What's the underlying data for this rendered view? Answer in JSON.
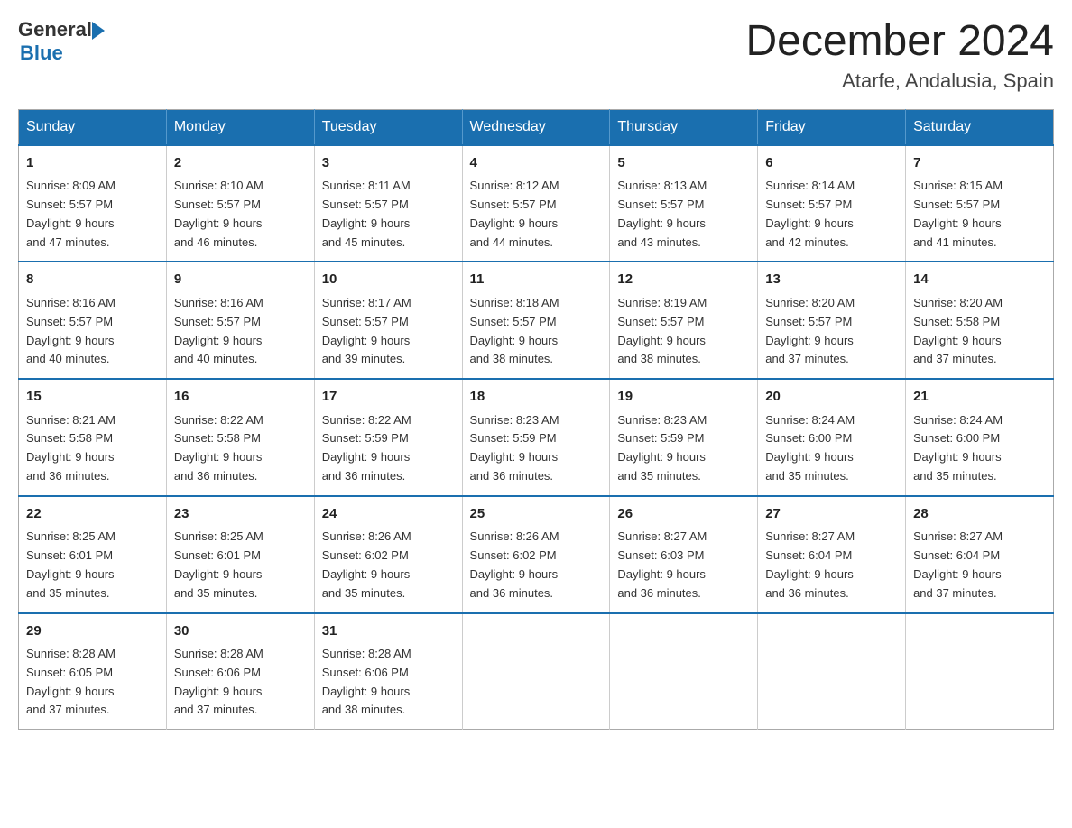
{
  "header": {
    "logo_general": "General",
    "logo_blue": "Blue",
    "title": "December 2024",
    "subtitle": "Atarfe, Andalusia, Spain"
  },
  "weekdays": [
    "Sunday",
    "Monday",
    "Tuesday",
    "Wednesday",
    "Thursday",
    "Friday",
    "Saturday"
  ],
  "weeks": [
    [
      {
        "day": "1",
        "sunrise": "8:09 AM",
        "sunset": "5:57 PM",
        "daylight": "9 hours and 47 minutes."
      },
      {
        "day": "2",
        "sunrise": "8:10 AM",
        "sunset": "5:57 PM",
        "daylight": "9 hours and 46 minutes."
      },
      {
        "day": "3",
        "sunrise": "8:11 AM",
        "sunset": "5:57 PM",
        "daylight": "9 hours and 45 minutes."
      },
      {
        "day": "4",
        "sunrise": "8:12 AM",
        "sunset": "5:57 PM",
        "daylight": "9 hours and 44 minutes."
      },
      {
        "day": "5",
        "sunrise": "8:13 AM",
        "sunset": "5:57 PM",
        "daylight": "9 hours and 43 minutes."
      },
      {
        "day": "6",
        "sunrise": "8:14 AM",
        "sunset": "5:57 PM",
        "daylight": "9 hours and 42 minutes."
      },
      {
        "day": "7",
        "sunrise": "8:15 AM",
        "sunset": "5:57 PM",
        "daylight": "9 hours and 41 minutes."
      }
    ],
    [
      {
        "day": "8",
        "sunrise": "8:16 AM",
        "sunset": "5:57 PM",
        "daylight": "9 hours and 40 minutes."
      },
      {
        "day": "9",
        "sunrise": "8:16 AM",
        "sunset": "5:57 PM",
        "daylight": "9 hours and 40 minutes."
      },
      {
        "day": "10",
        "sunrise": "8:17 AM",
        "sunset": "5:57 PM",
        "daylight": "9 hours and 39 minutes."
      },
      {
        "day": "11",
        "sunrise": "8:18 AM",
        "sunset": "5:57 PM",
        "daylight": "9 hours and 38 minutes."
      },
      {
        "day": "12",
        "sunrise": "8:19 AM",
        "sunset": "5:57 PM",
        "daylight": "9 hours and 38 minutes."
      },
      {
        "day": "13",
        "sunrise": "8:20 AM",
        "sunset": "5:57 PM",
        "daylight": "9 hours and 37 minutes."
      },
      {
        "day": "14",
        "sunrise": "8:20 AM",
        "sunset": "5:58 PM",
        "daylight": "9 hours and 37 minutes."
      }
    ],
    [
      {
        "day": "15",
        "sunrise": "8:21 AM",
        "sunset": "5:58 PM",
        "daylight": "9 hours and 36 minutes."
      },
      {
        "day": "16",
        "sunrise": "8:22 AM",
        "sunset": "5:58 PM",
        "daylight": "9 hours and 36 minutes."
      },
      {
        "day": "17",
        "sunrise": "8:22 AM",
        "sunset": "5:59 PM",
        "daylight": "9 hours and 36 minutes."
      },
      {
        "day": "18",
        "sunrise": "8:23 AM",
        "sunset": "5:59 PM",
        "daylight": "9 hours and 36 minutes."
      },
      {
        "day": "19",
        "sunrise": "8:23 AM",
        "sunset": "5:59 PM",
        "daylight": "9 hours and 35 minutes."
      },
      {
        "day": "20",
        "sunrise": "8:24 AM",
        "sunset": "6:00 PM",
        "daylight": "9 hours and 35 minutes."
      },
      {
        "day": "21",
        "sunrise": "8:24 AM",
        "sunset": "6:00 PM",
        "daylight": "9 hours and 35 minutes."
      }
    ],
    [
      {
        "day": "22",
        "sunrise": "8:25 AM",
        "sunset": "6:01 PM",
        "daylight": "9 hours and 35 minutes."
      },
      {
        "day": "23",
        "sunrise": "8:25 AM",
        "sunset": "6:01 PM",
        "daylight": "9 hours and 35 minutes."
      },
      {
        "day": "24",
        "sunrise": "8:26 AM",
        "sunset": "6:02 PM",
        "daylight": "9 hours and 35 minutes."
      },
      {
        "day": "25",
        "sunrise": "8:26 AM",
        "sunset": "6:02 PM",
        "daylight": "9 hours and 36 minutes."
      },
      {
        "day": "26",
        "sunrise": "8:27 AM",
        "sunset": "6:03 PM",
        "daylight": "9 hours and 36 minutes."
      },
      {
        "day": "27",
        "sunrise": "8:27 AM",
        "sunset": "6:04 PM",
        "daylight": "9 hours and 36 minutes."
      },
      {
        "day": "28",
        "sunrise": "8:27 AM",
        "sunset": "6:04 PM",
        "daylight": "9 hours and 37 minutes."
      }
    ],
    [
      {
        "day": "29",
        "sunrise": "8:28 AM",
        "sunset": "6:05 PM",
        "daylight": "9 hours and 37 minutes."
      },
      {
        "day": "30",
        "sunrise": "8:28 AM",
        "sunset": "6:06 PM",
        "daylight": "9 hours and 37 minutes."
      },
      {
        "day": "31",
        "sunrise": "8:28 AM",
        "sunset": "6:06 PM",
        "daylight": "9 hours and 38 minutes."
      },
      null,
      null,
      null,
      null
    ]
  ],
  "labels": {
    "sunrise_prefix": "Sunrise: ",
    "sunset_prefix": "Sunset: ",
    "daylight_prefix": "Daylight: "
  }
}
